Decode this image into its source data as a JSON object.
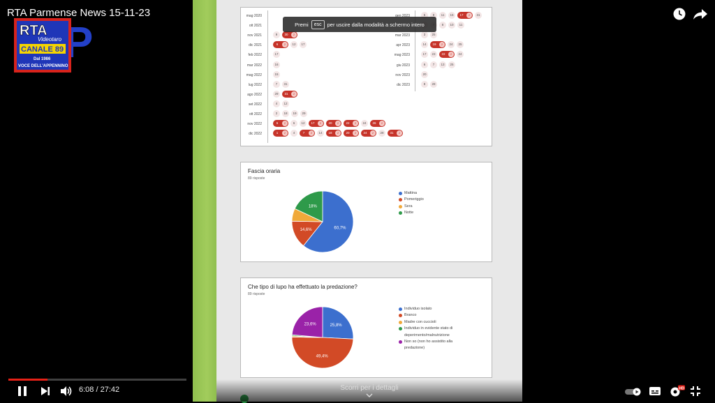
{
  "player": {
    "title": "RTA Parmense News 15-11-23",
    "time_current": "6:08",
    "time_separator": " / ",
    "time_total": "27:42",
    "progress_fraction": 0.2214,
    "toast_prefix": "Premi",
    "toast_key": "esc",
    "toast_suffix": "per uscire dalla modalità a schermo intero",
    "scroll_hint": "Scorri per i dettagli",
    "hd_badge": "HD",
    "accent": "#e62117"
  },
  "logo": {
    "line1": "RTA",
    "line2": "Videotaro",
    "line3": "CANALE 89",
    "line4": "Dal 1986",
    "line5": "VOCE DELL'APPENNINO",
    "letter": "P"
  },
  "calendar": {
    "left_rows": [
      {
        "month": "mag 2020",
        "days": []
      },
      {
        "month": "ott 2021",
        "days": []
      },
      {
        "month": "nov 2021",
        "days": [
          {
            "d": "9"
          },
          {
            "d": "30",
            "n": "2"
          }
        ]
      },
      {
        "month": "dic 2021",
        "days": [
          {
            "d": "6",
            "n": "2"
          },
          {
            "d": "12"
          },
          {
            "d": "17"
          }
        ]
      },
      {
        "month": "feb 2022",
        "days": [
          {
            "d": "17"
          }
        ]
      },
      {
        "month": "mar 2022",
        "days": [
          {
            "d": "16"
          }
        ]
      },
      {
        "month": "mag 2022",
        "days": [
          {
            "d": "15"
          }
        ]
      },
      {
        "month": "lug 2022",
        "days": [
          {
            "d": "7"
          },
          {
            "d": "31"
          }
        ]
      },
      {
        "month": "ago 2022",
        "days": [
          {
            "d": "29"
          },
          {
            "d": "31",
            "n": "2"
          }
        ]
      },
      {
        "month": "set 2022",
        "days": [
          {
            "d": "4"
          },
          {
            "d": "12"
          }
        ]
      },
      {
        "month": "ott 2022",
        "days": [
          {
            "d": "2"
          },
          {
            "d": "18"
          },
          {
            "d": "19"
          },
          {
            "d": "29"
          }
        ]
      },
      {
        "month": "nov 2022",
        "days": [
          {
            "d": "5",
            "n": "2"
          },
          {
            "d": "6"
          },
          {
            "d": "12"
          },
          {
            "d": "17",
            "n": "2"
          },
          {
            "d": "20",
            "n": "2"
          },
          {
            "d": "22",
            "n": "2"
          },
          {
            "d": "24"
          },
          {
            "d": "26",
            "n": "2"
          }
        ]
      },
      {
        "month": "dic 2022",
        "days": [
          {
            "d": "1",
            "n": "2"
          },
          {
            "d": "4"
          },
          {
            "d": "7",
            "n": "2"
          },
          {
            "d": "14"
          },
          {
            "d": "18",
            "n": "2"
          },
          {
            "d": "20",
            "n": "2"
          },
          {
            "d": "24",
            "n": "2"
          },
          {
            "d": "28"
          },
          {
            "d": "31",
            "n": "2"
          }
        ]
      }
    ],
    "right_rows": [
      {
        "month": "gen 2023",
        "days": [
          {
            "d": "5"
          },
          {
            "d": "8"
          },
          {
            "d": "11"
          },
          {
            "d": "15"
          },
          {
            "d": "17",
            "n": "2"
          },
          {
            "d": "31"
          }
        ]
      },
      {
        "month": "feb 2023",
        "days": [
          {
            "d": "5"
          },
          {
            "d": "7"
          },
          {
            "d": "8"
          },
          {
            "d": "10"
          },
          {
            "d": "11"
          }
        ]
      },
      {
        "month": "mar 2023",
        "days": [
          {
            "d": "3"
          },
          {
            "d": "25"
          }
        ]
      },
      {
        "month": "apr 2023",
        "days": [
          {
            "d": "14"
          },
          {
            "d": "19",
            "n": "2"
          },
          {
            "d": "24"
          },
          {
            "d": "25"
          }
        ]
      },
      {
        "month": "mag 2023",
        "days": [
          {
            "d": "17"
          },
          {
            "d": "23"
          },
          {
            "d": "22",
            "n": "2"
          },
          {
            "d": "24"
          }
        ]
      },
      {
        "month": "giu 2023",
        "days": [
          {
            "d": "6"
          },
          {
            "d": "7"
          },
          {
            "d": "13"
          },
          {
            "d": "25"
          }
        ]
      },
      {
        "month": "nov 2023",
        "days": [
          {
            "d": "20"
          }
        ]
      },
      {
        "month": "dic 2023",
        "days": [
          {
            "d": "8"
          },
          {
            "d": "28"
          }
        ]
      }
    ]
  },
  "chart_data": [
    {
      "type": "pie",
      "title": "Fascia oraria",
      "subtitle": "89 risposte",
      "legend_position": "right",
      "slices": [
        {
          "label": "Mattina",
          "value": 60.7,
          "color": "#3c6fce",
          "text": "60,7%"
        },
        {
          "label": "Pomeriggio",
          "value": 14.6,
          "color": "#d24a26",
          "text": "14,6%"
        },
        {
          "label": "Sera",
          "value": 6.7,
          "color": "#f0a93a",
          "text": ""
        },
        {
          "label": "Notte",
          "value": 18.0,
          "color": "#2e9a4a",
          "text": "18%"
        }
      ]
    },
    {
      "type": "pie",
      "title": "Che tipo di lupo ha effettuato la predazione?",
      "subtitle": "89 risposte",
      "legend_position": "right",
      "slices": [
        {
          "label": "Individuo isolato",
          "value": 25.8,
          "color": "#3c6fce",
          "text": "25,8%"
        },
        {
          "label": "Branco",
          "value": 49.4,
          "color": "#d24a26",
          "text": "49,4%"
        },
        {
          "label": "Madre con cuccioli",
          "value": 0.6,
          "color": "#f0a93a",
          "text": ""
        },
        {
          "label": "Individuo in evidente stato di deperimento/malnutrizione",
          "value": 0.6,
          "color": "#2e9a4a",
          "text": ""
        },
        {
          "label": "Non so (non ho assistito alla predazione)",
          "value": 23.6,
          "color": "#9a22a8",
          "text": "23,6%"
        }
      ]
    }
  ]
}
